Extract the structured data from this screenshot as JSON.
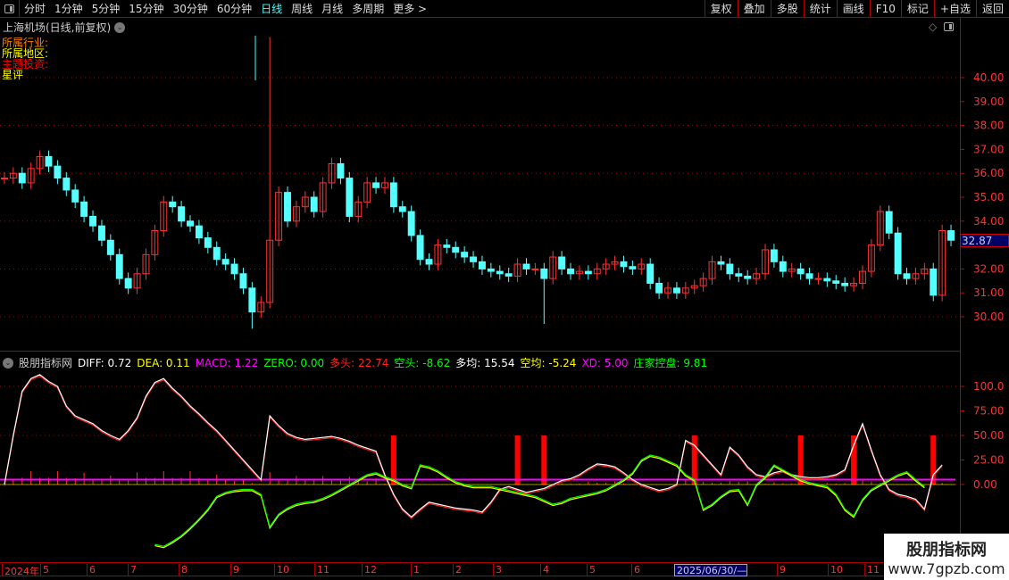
{
  "toolbar": {
    "periods": [
      "分时",
      "1分钟",
      "5分钟",
      "15分钟",
      "30分钟",
      "60分钟",
      "日线",
      "周线",
      "月线",
      "多周期",
      "更多 >"
    ],
    "active": "日线",
    "right_buttons": [
      "复权",
      "叠加",
      "多股",
      "统计",
      "画线",
      "F10",
      "标记",
      "+自选",
      "返回"
    ]
  },
  "title": "上海机场(日线,前复权)",
  "info": [
    {
      "text": "所属行业:",
      "color": "#ff8000"
    },
    {
      "text": "所属地区:",
      "color": "#ffff00"
    },
    {
      "text": "主题投资:",
      "color": "#ff0000"
    },
    {
      "text": "星评",
      "color": "#ffff00"
    }
  ],
  "price_tag": "32.87",
  "sub_header": {
    "name": "股朋指标网",
    "items": [
      {
        "label": "DIFF: 0.72",
        "color": "#ffffff"
      },
      {
        "label": "DEA: 0.11",
        "color": "#ffff00"
      },
      {
        "label": "MACD: 1.22",
        "color": "#ff00ff"
      },
      {
        "label": "ZERO: 0.00",
        "color": "#00ff00"
      },
      {
        "label": "多头: 22.74",
        "color": "#ff2020"
      },
      {
        "label": "空头: -8.62",
        "color": "#00ff00"
      },
      {
        "label": "多均: 15.54",
        "color": "#ffffff"
      },
      {
        "label": "空均: -5.24",
        "color": "#ffff00"
      },
      {
        "label": "XD: 5.00",
        "color": "#ff00ff"
      },
      {
        "label": "庄家控盘: 9.81",
        "color": "#00ff00"
      }
    ]
  },
  "dates": [
    "2024年",
    "5",
    "6",
    "7",
    "8",
    "9",
    "10",
    "11",
    "12",
    "1",
    "2",
    "3",
    "4",
    "5",
    "6",
    "2025/06/30/—",
    "9",
    "10",
    "11"
  ],
  "watermark": {
    "line1": "股朋指标网",
    "line2": "www.7gpzb.com"
  },
  "chart_data": {
    "type": "candlestick",
    "price_axis": {
      "ticks": [
        "40.00",
        "39.00",
        "38.00",
        "37.00",
        "36.00",
        "35.00",
        "34.00",
        "32.00",
        "31.00",
        "30.00"
      ],
      "range": [
        28.8,
        42.0
      ]
    },
    "closes": [
      35.8,
      36.0,
      35.6,
      36.2,
      36.7,
      36.3,
      35.8,
      35.3,
      34.8,
      34.2,
      33.8,
      33.2,
      32.6,
      31.6,
      31.2,
      31.8,
      32.6,
      33.6,
      34.8,
      34.6,
      34.0,
      33.8,
      33.3,
      32.9,
      32.4,
      32.2,
      31.8,
      31.2,
      30.2,
      30.6,
      33.2,
      35.2,
      34.0,
      34.6,
      35.0,
      34.4,
      35.6,
      36.4,
      35.8,
      34.2,
      34.8,
      35.6,
      35.4,
      35.6,
      34.6,
      34.4,
      33.4,
      32.4,
      32.2,
      33.0,
      32.9,
      32.7,
      32.5,
      32.3,
      32.0,
      31.9,
      31.8,
      31.7,
      32.2,
      32.0,
      32.0,
      31.6,
      32.5,
      32.0,
      31.8,
      31.9,
      31.8,
      32.0,
      32.2,
      32.3,
      32.1,
      32.0,
      32.2,
      31.4,
      31.0,
      31.2,
      31.0,
      31.2,
      31.3,
      31.6,
      32.3,
      32.2,
      31.8,
      31.7,
      31.6,
      31.8,
      32.8,
      32.3,
      31.9,
      32.0,
      31.8,
      31.6,
      31.6,
      31.5,
      31.4,
      31.3,
      31.4,
      31.9,
      33.0,
      34.4,
      33.5,
      31.8,
      31.6,
      31.8,
      32.0,
      30.9,
      33.6,
      33.2
    ],
    "extremes": [
      {
        "i": 30,
        "high": 41.7
      },
      {
        "i": 61,
        "low": 29.7
      },
      {
        "i": 28,
        "low": 29.5
      }
    ],
    "sub_axis": {
      "ticks": [
        "100.0",
        "75.00",
        "50.00",
        "25.00",
        "0.00"
      ],
      "range": [
        -80,
        120
      ]
    },
    "duotou": [
      0,
      50,
      95,
      108,
      112,
      105,
      100,
      80,
      70,
      66,
      62,
      55,
      50,
      46,
      55,
      68,
      90,
      104,
      108,
      98,
      90,
      80,
      72,
      63,
      55,
      45,
      35,
      25,
      15,
      5,
      70,
      60,
      52,
      48,
      46,
      47,
      48,
      49,
      47,
      44,
      40,
      37,
      34,
      10,
      -10,
      -25,
      -33,
      -25,
      -18,
      -20,
      -22,
      -24,
      -25,
      -26,
      -28,
      -18,
      -5,
      -2,
      -5,
      -8,
      -6,
      -4,
      0,
      4,
      6,
      10,
      16,
      21,
      20,
      18,
      12,
      5,
      0,
      -3,
      -6,
      -4,
      0,
      45,
      40,
      30,
      20,
      10,
      38,
      30,
      18,
      10,
      8,
      12,
      14,
      10,
      8,
      7,
      7,
      8,
      10,
      15,
      40,
      62,
      35,
      10,
      -5,
      -10,
      -12,
      -15,
      -25,
      10,
      20
    ],
    "kongtou": [
      null,
      null,
      null,
      null,
      null,
      null,
      null,
      null,
      null,
      null,
      null,
      null,
      null,
      null,
      null,
      null,
      null,
      -61,
      -63,
      -58,
      -52,
      -44,
      -35,
      -25,
      -12,
      -8,
      -6,
      -5,
      -5,
      -10,
      -43,
      -30,
      -24,
      -20,
      -18,
      -17,
      -14,
      -10,
      -5,
      0,
      5,
      10,
      12,
      8,
      5,
      0,
      -3,
      20,
      18,
      14,
      8,
      3,
      0,
      -2,
      -2,
      -2,
      -4,
      -6,
      -8,
      -10,
      -12,
      -16,
      -20,
      -18,
      -14,
      -12,
      -10,
      -8,
      -5,
      0,
      5,
      12,
      25,
      30,
      28,
      24,
      20,
      10,
      5,
      -25,
      -20,
      -12,
      -6,
      -5,
      -20,
      0,
      8,
      20,
      15,
      10,
      5,
      2,
      0,
      -2,
      -10,
      -25,
      -32,
      -15,
      -5,
      0,
      5,
      10,
      13,
      5,
      -2
    ],
    "signal_bars_value": 50,
    "signal_bars_index": [
      44,
      58,
      61,
      78,
      90,
      96,
      105
    ],
    "xd_value": 5
  }
}
